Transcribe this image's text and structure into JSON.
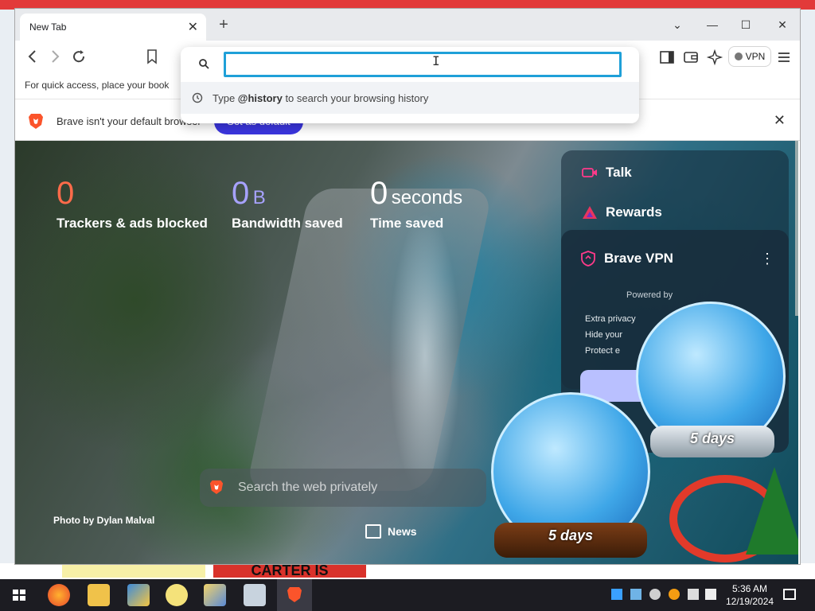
{
  "browser": {
    "tab_title": "New Tab",
    "new_tab_symbol": "+",
    "tab_close_symbol": "✕",
    "window_controls": {
      "dropdown": "⌄",
      "minimize": "—",
      "maximize": "☐",
      "close": "✕"
    },
    "bookmark_hint": "For quick access, place your book",
    "vpn_label": "VPN",
    "icons": [
      "back-icon",
      "forward-icon",
      "reload-icon",
      "bookmark-icon",
      "sidebar-icon",
      "wallet-icon",
      "leo-ai-icon",
      "vpn-icon",
      "menu-icon"
    ]
  },
  "omnibox": {
    "input_value": "",
    "suggestion_prefix": "Type ",
    "suggestion_keyword": "@history",
    "suggestion_suffix": " to search your browsing history"
  },
  "infobar": {
    "message": "Brave isn't your default browser",
    "button_label": "Set as default",
    "close_symbol": "✕"
  },
  "ntp": {
    "stats": [
      {
        "value": "0",
        "unit": "",
        "label": "Trackers & ads blocked",
        "color": "#ff6b4a"
      },
      {
        "value": "0",
        "unit": "B",
        "label": "Bandwidth saved",
        "color": "#a7a2ff"
      },
      {
        "value": "0",
        "unit": "seconds",
        "label": "Time saved",
        "color": "#ffffff"
      }
    ],
    "widgets": {
      "talk": "Talk",
      "rewards": "Rewards",
      "vpn_title": "Brave VPN",
      "vpn_menu": "⋮",
      "powered_by": "Powered by",
      "bullets": [
        "Extra privacy",
        "Hide your",
        "Protect e"
      ]
    },
    "search_placeholder": "Search the web privately",
    "photo_credit": "Photo by Dylan Malval",
    "news_label": "News",
    "globe_labels": [
      "5 days",
      "5 days"
    ]
  },
  "taskbar": {
    "time": "5:36 AM",
    "date": "12/19/2024",
    "items": [
      "windows-start",
      "firefox",
      "file-explorer",
      "app-1",
      "chat-app",
      "app-2",
      "app-3",
      "brave"
    ]
  },
  "colors": {
    "accent_blue": "#3b36e0",
    "omnibox_focus": "#1fa0d8",
    "brave_orange": "#fb542b"
  },
  "desktop": {
    "banner_text": "CARTER IS"
  }
}
